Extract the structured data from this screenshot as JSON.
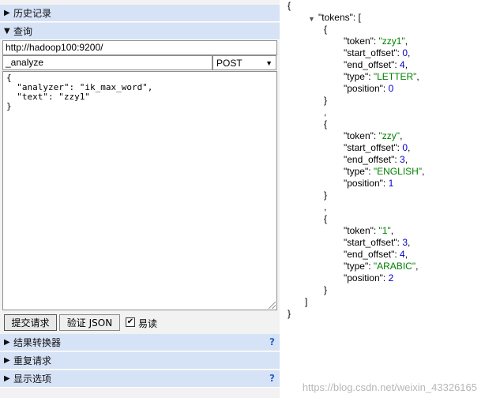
{
  "sections": {
    "history": "历史记录",
    "query": "查询",
    "transformer": "结果转换器",
    "repeat": "重复请求",
    "display": "显示选项",
    "help": "?"
  },
  "request": {
    "url": "http://hadoop100:9200/",
    "path": "_analyze",
    "method": "POST",
    "body": "{\n  \"analyzer\": \"ik_max_word\",\n  \"text\": \"zzy1\"\n}"
  },
  "buttons": {
    "submit": "提交请求",
    "validate": "验证 JSON",
    "pretty_label": "易读",
    "pretty_checked": true
  },
  "response": {
    "open_brace": "{",
    "close_brace": "}",
    "root_key": "\"tokens\": [",
    "close_bracket": "]",
    "tokens": [
      {
        "token": "\"zzy1\"",
        "start_offset": "0",
        "end_offset": "4",
        "type": "\"LETTER\"",
        "position": "0"
      },
      {
        "token": "\"zzy\"",
        "start_offset": "0",
        "end_offset": "3",
        "type": "\"ENGLISH\"",
        "position": "1"
      },
      {
        "token": "\"1\"",
        "start_offset": "3",
        "end_offset": "4",
        "type": "\"ARABIC\"",
        "position": "2"
      }
    ]
  },
  "watermark": "https://blog.csdn.net/weixin_43326165"
}
